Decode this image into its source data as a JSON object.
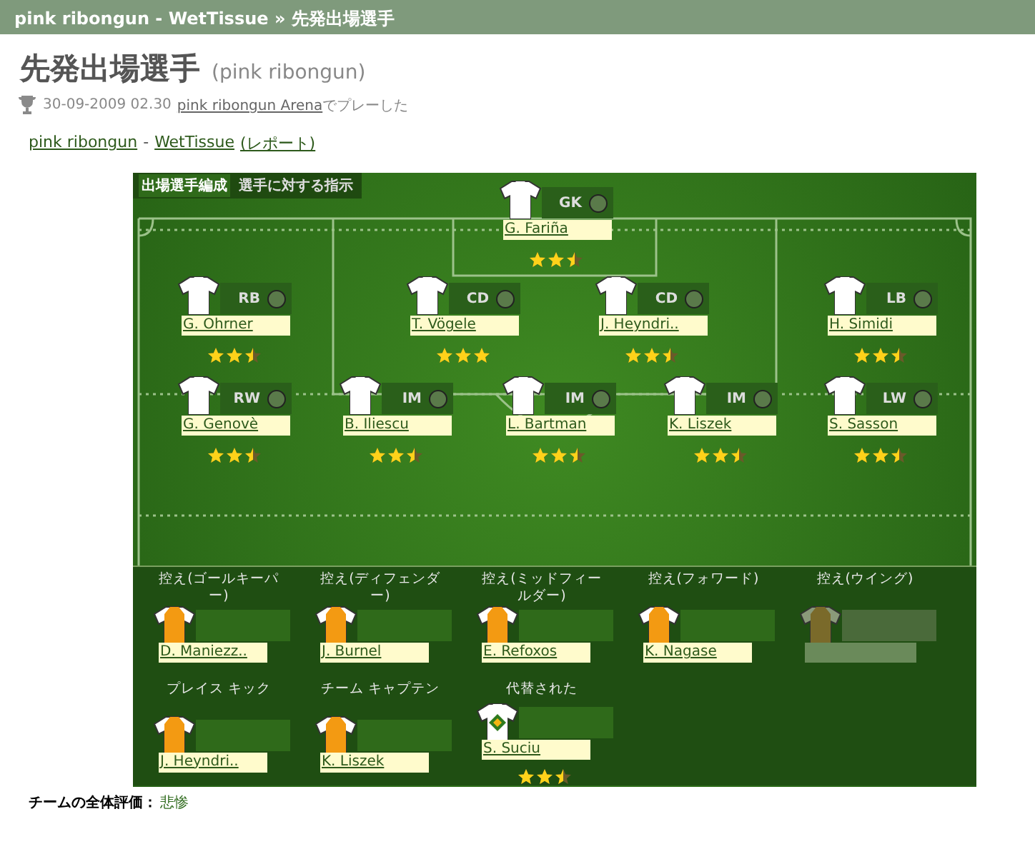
{
  "breadcrumb": "pink ribongun - WetTissue » 先発出場選手",
  "title": "先発出場選手",
  "subtitle": "(pink ribongun)",
  "match_info": {
    "date": "30-09-2009 02.30",
    "arena_link": "pink ribongun Arena",
    "suffix": "でプレーした"
  },
  "teams": {
    "home": "pink ribongun",
    "separator": "-",
    "away": "WetTissue",
    "report": "(レポート)"
  },
  "tabs": [
    {
      "label": "出場選手編成",
      "selected": true
    },
    {
      "label": "選手に対する指示",
      "selected": false
    }
  ],
  "starters": [
    {
      "position": "GK",
      "name": "G. Fariña",
      "stars": 2.5
    },
    {
      "position": "RB",
      "name": "G. Ohrner",
      "stars": 2.5
    },
    {
      "position": "CD",
      "name": "T. Vögele",
      "stars": 3
    },
    {
      "position": "CD",
      "name": "J. Heyndri..",
      "stars": 2.5
    },
    {
      "position": "LB",
      "name": "H. Simidi",
      "stars": 2.5
    },
    {
      "position": "RW",
      "name": "G. Genovè",
      "stars": 2.5
    },
    {
      "position": "IM",
      "name": "B. Iliescu",
      "stars": 2.5
    },
    {
      "position": "IM",
      "name": "L. Bartman",
      "stars": 2.5
    },
    {
      "position": "IM",
      "name": "K. Liszek",
      "stars": 2.5
    },
    {
      "position": "LW",
      "name": "S. Sasson",
      "stars": 2.5
    }
  ],
  "bench": [
    {
      "label": "控え(ゴールキーパー)",
      "kind": "sub",
      "name": "D. Maniezz.."
    },
    {
      "label": "控え(ディフェンダー)",
      "kind": "sub",
      "name": "J. Burnel"
    },
    {
      "label": "控え(ミッドフィールダー)",
      "kind": "sub",
      "name": "E. Refoxos"
    },
    {
      "label": "控え(フォワード)",
      "kind": "sub",
      "name": "K. Nagase"
    },
    {
      "label": "控え(ウイング)",
      "kind": "empty"
    },
    {
      "label": "プレイス キック",
      "kind": "sub",
      "name": "J. Heyndri.."
    },
    {
      "label": "チーム キャプテン",
      "kind": "sub",
      "name": "K. Liszek"
    },
    {
      "label": "代替された",
      "kind": "replaced",
      "name": "S. Suciu",
      "stars": 2.5
    }
  ],
  "rating": {
    "label": "チームの全体評価：",
    "value": "悲惨"
  }
}
